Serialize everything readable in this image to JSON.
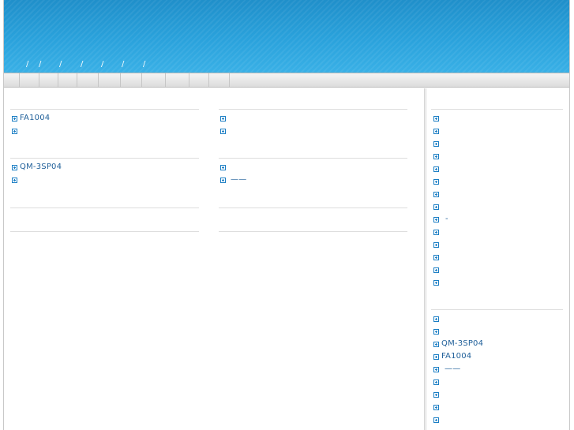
{
  "header": {
    "breadcrumb_separators": [
      "/",
      "/",
      "/",
      "/",
      "/",
      "/",
      "/"
    ]
  },
  "nav": {
    "item_count": 11
  },
  "left_column": {
    "block1": [
      {
        "label": "FA1004",
        "underline": false
      },
      {
        "label": "",
        "underline": false
      }
    ],
    "block2": [
      {
        "label": "QM-3SP04",
        "underline": false
      },
      {
        "label": "",
        "underline": false
      }
    ]
  },
  "middle_column": {
    "block1": [
      {
        "label": "",
        "underline": false
      },
      {
        "label": "",
        "underline": false
      }
    ],
    "block2": [
      {
        "label": "",
        "underline": false
      },
      {
        "label": "——",
        "underline": false
      }
    ]
  },
  "right_column": {
    "list1": [
      {
        "label": ""
      },
      {
        "label": ""
      },
      {
        "label": ""
      },
      {
        "label": ""
      },
      {
        "label": ""
      },
      {
        "label": ""
      },
      {
        "label": ""
      },
      {
        "label": ""
      },
      {
        "label": " -"
      },
      {
        "label": ""
      },
      {
        "label": ""
      },
      {
        "label": ""
      },
      {
        "label": ""
      },
      {
        "label": ""
      }
    ],
    "list2": [
      {
        "label": ""
      },
      {
        "label": ""
      },
      {
        "label": "QM-3SP04"
      },
      {
        "label": "FA1004"
      },
      {
        "label": "——"
      },
      {
        "label": ""
      },
      {
        "label": ""
      },
      {
        "label": ""
      },
      {
        "label": ""
      }
    ]
  },
  "colors": {
    "header_top": "#1f8fca",
    "header_bottom": "#39b0e6",
    "link": "#1f5f99",
    "bullet": "#1b7ec4"
  }
}
